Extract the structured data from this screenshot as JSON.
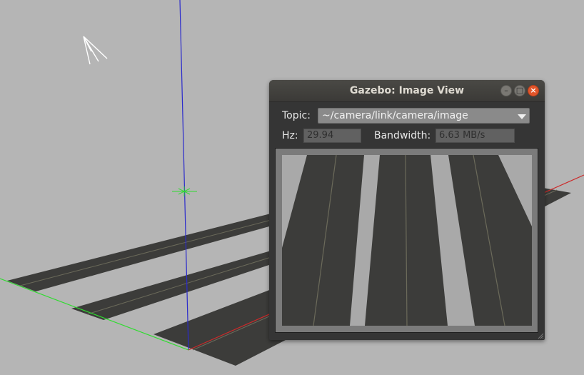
{
  "window": {
    "title": "Gazebo: Image View",
    "minimize_icon": "minimize-icon",
    "maximize_icon": "maximize-icon",
    "close_icon": "close-icon"
  },
  "topic": {
    "label": "Topic:",
    "value": "~/camera/link/camera/image"
  },
  "hz": {
    "label": "Hz:",
    "value": "29.94"
  },
  "bandwidth": {
    "label": "Bandwidth:",
    "value": "6.63 MB/s"
  },
  "colors": {
    "background": "#b5b5b5",
    "road": "#3c3c3a",
    "axis_x": "#cc2a2a",
    "axis_y": "#2fdc2f",
    "axis_z": "#2a2acc",
    "close_button": "#e1552a"
  }
}
